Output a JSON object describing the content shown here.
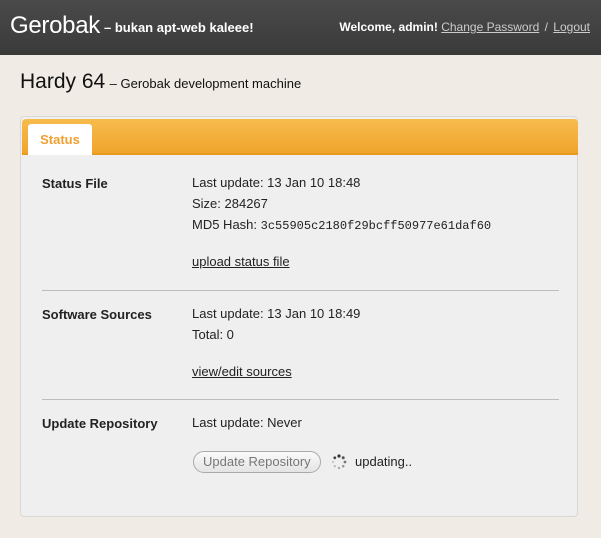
{
  "header": {
    "brand": "Gerobak",
    "tagline": "– bukan apt-web kaleee!",
    "welcome": "Welcome, admin!",
    "change_password": "Change Password",
    "separator": "/",
    "logout": "Logout"
  },
  "page": {
    "title": "Hardy 64",
    "subtitle": "– Gerobak development machine"
  },
  "tabs": [
    {
      "label": "Status",
      "active": true
    }
  ],
  "status_file": {
    "label": "Status File",
    "last_update": "Last update: 13 Jan 10 18:48",
    "size": "Size: 284267",
    "md5_label": "MD5 Hash:",
    "md5_value": "3c55905c2180f29bcff50977e61daf60",
    "link": "upload status file"
  },
  "software_sources": {
    "label": "Software Sources",
    "last_update": "Last update: 13 Jan 10 18:49",
    "total": "Total: 0",
    "link": "view/edit sources"
  },
  "update_repository": {
    "label": "Update Repository",
    "last_update": "Last update: Never",
    "button": "Update Repository",
    "status": "updating.."
  },
  "colors": {
    "accent": "#f0a42c",
    "topbar": "#3f3f3f",
    "background": "#f0ebe4"
  }
}
